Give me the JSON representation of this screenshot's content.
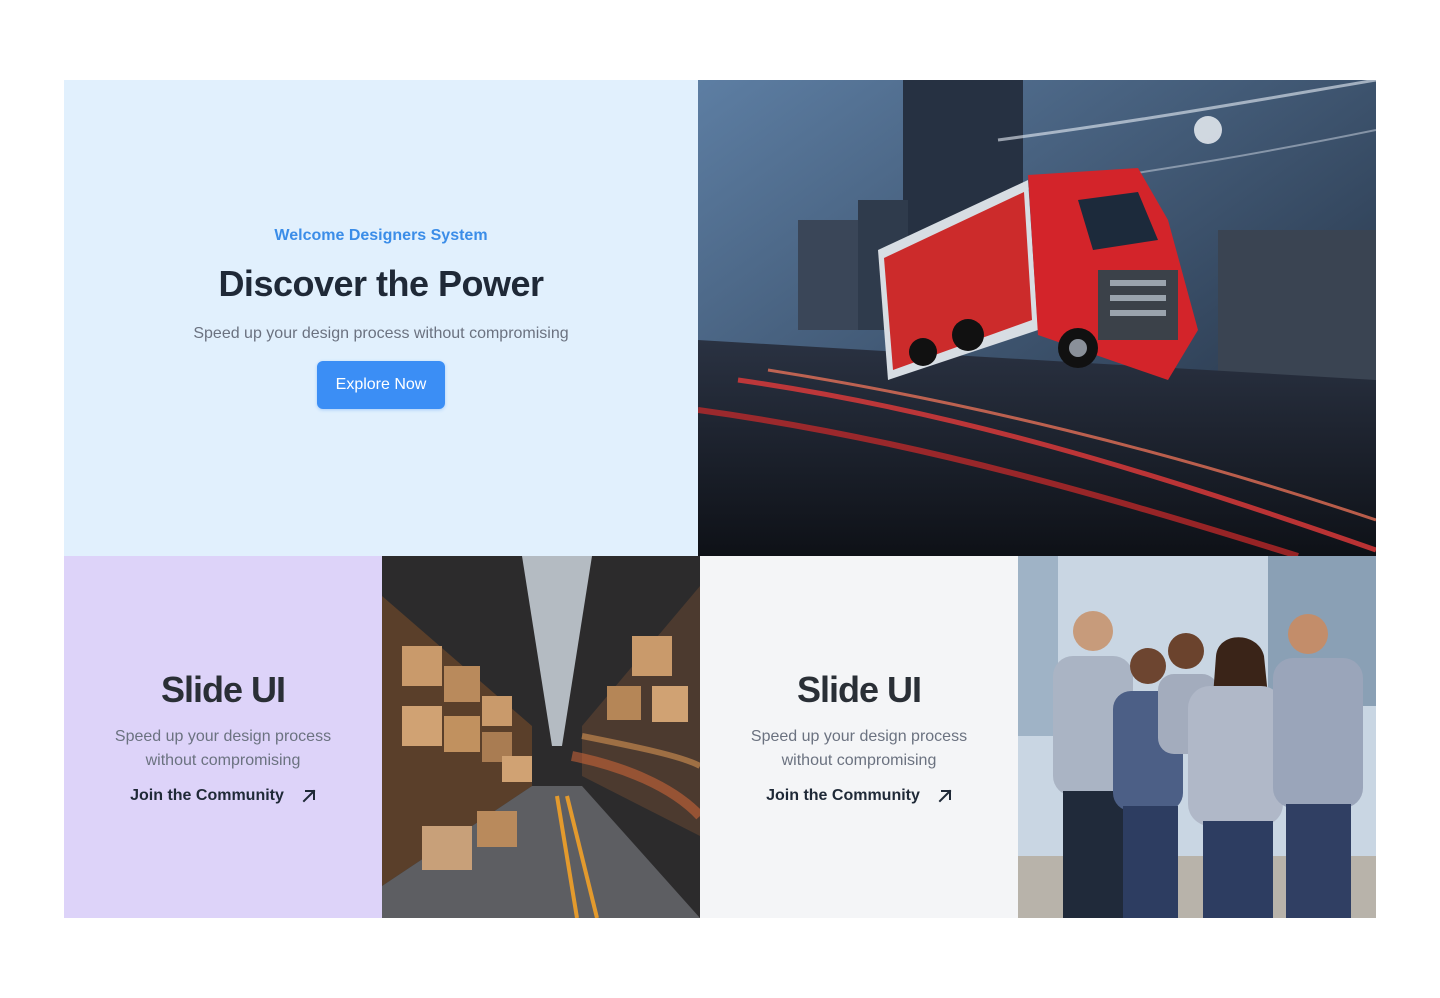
{
  "hero": {
    "eyebrow": "Welcome Designers System",
    "title": "Discover the Power",
    "subtitle": "Speed up your design process without compromising",
    "cta_label": "Explore Now"
  },
  "cards": [
    {
      "title": "Slide UI",
      "subtitle": "Speed up your design process without compromising",
      "link_label": "Join the Community",
      "link_icon": "arrow-up-right-icon"
    },
    {
      "title": "Slide UI",
      "subtitle": "Speed up your design process without compromising",
      "link_label": "Join the Community",
      "link_icon": "arrow-up-right-icon"
    }
  ],
  "images": {
    "hero": "truck-photo",
    "warehouse": "warehouse-photo",
    "team": "team-photo"
  },
  "colors": {
    "hero_bg": "#e1f0fd",
    "accent": "#3b8ef5",
    "purple_card": "#ddd3f9",
    "gray_card": "#f4f5f7",
    "heading": "#1f2937",
    "muted": "#6b7280"
  }
}
